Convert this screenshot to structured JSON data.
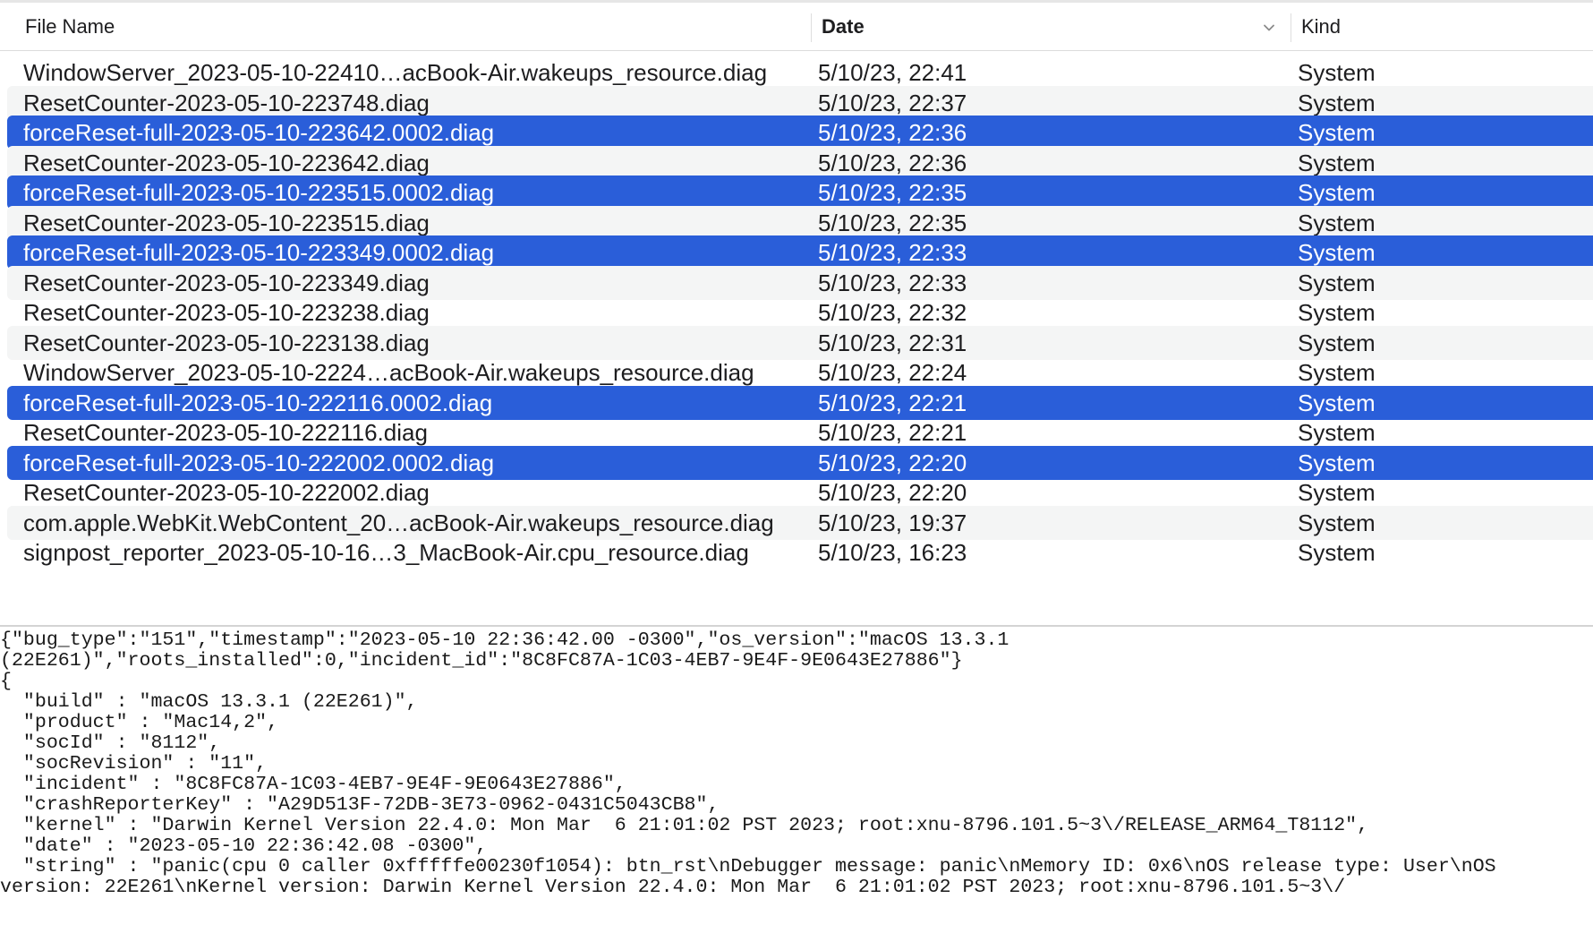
{
  "columns": {
    "name": "File Name",
    "date": "Date",
    "kind": "Kind"
  },
  "files": [
    {
      "name": "WindowServer_2023-05-10-22410…acBook-Air.wakeups_resource.diag",
      "date": "5/10/23, 22:41",
      "kind": "System",
      "selected": false
    },
    {
      "name": "ResetCounter-2023-05-10-223748.diag",
      "date": "5/10/23, 22:37",
      "kind": "System",
      "selected": false
    },
    {
      "name": "forceReset-full-2023-05-10-223642.0002.diag",
      "date": "5/10/23, 22:36",
      "kind": "System",
      "selected": true
    },
    {
      "name": "ResetCounter-2023-05-10-223642.diag",
      "date": "5/10/23, 22:36",
      "kind": "System",
      "selected": false
    },
    {
      "name": "forceReset-full-2023-05-10-223515.0002.diag",
      "date": "5/10/23, 22:35",
      "kind": "System",
      "selected": true
    },
    {
      "name": "ResetCounter-2023-05-10-223515.diag",
      "date": "5/10/23, 22:35",
      "kind": "System",
      "selected": false
    },
    {
      "name": "forceReset-full-2023-05-10-223349.0002.diag",
      "date": "5/10/23, 22:33",
      "kind": "System",
      "selected": true
    },
    {
      "name": "ResetCounter-2023-05-10-223349.diag",
      "date": "5/10/23, 22:33",
      "kind": "System",
      "selected": false
    },
    {
      "name": "ResetCounter-2023-05-10-223238.diag",
      "date": "5/10/23, 22:32",
      "kind": "System",
      "selected": false
    },
    {
      "name": "ResetCounter-2023-05-10-223138.diag",
      "date": "5/10/23, 22:31",
      "kind": "System",
      "selected": false
    },
    {
      "name": "WindowServer_2023-05-10-2224…acBook-Air.wakeups_resource.diag",
      "date": "5/10/23, 22:24",
      "kind": "System",
      "selected": false
    },
    {
      "name": "forceReset-full-2023-05-10-222116.0002.diag",
      "date": "5/10/23, 22:21",
      "kind": "System",
      "selected": true
    },
    {
      "name": "ResetCounter-2023-05-10-222116.diag",
      "date": "5/10/23, 22:21",
      "kind": "System",
      "selected": false
    },
    {
      "name": "forceReset-full-2023-05-10-222002.0002.diag",
      "date": "5/10/23, 22:20",
      "kind": "System",
      "selected": true
    },
    {
      "name": "ResetCounter-2023-05-10-222002.diag",
      "date": "5/10/23, 22:20",
      "kind": "System",
      "selected": false
    },
    {
      "name": "com.apple.WebKit.WebContent_20…acBook-Air.wakeups_resource.diag",
      "date": "5/10/23, 19:37",
      "kind": "System",
      "selected": false
    },
    {
      "name": "signpost_reporter_2023-05-10-16…3_MacBook-Air.cpu_resource.diag",
      "date": "5/10/23, 16:23",
      "kind": "System",
      "selected": false
    }
  ],
  "content_lines": [
    "{\"bug_type\":\"151\",\"timestamp\":\"2023-05-10 22:36:42.00 -0300\",\"os_version\":\"macOS 13.3.1",
    "(22E261)\",\"roots_installed\":0,\"incident_id\":\"8C8FC87A-1C03-4EB7-9E4F-9E0643E27886\"}",
    "{",
    "  \"build\" : \"macOS 13.3.1 (22E261)\",",
    "  \"product\" : \"Mac14,2\",",
    "  \"socId\" : \"8112\",",
    "  \"socRevision\" : \"11\",",
    "  \"incident\" : \"8C8FC87A-1C03-4EB7-9E4F-9E0643E27886\",",
    "  \"crashReporterKey\" : \"A29D513F-72DB-3E73-0962-0431C5043CB8\",",
    "  \"kernel\" : \"Darwin Kernel Version 22.4.0: Mon Mar  6 21:01:02 PST 2023; root:xnu-8796.101.5~3\\/RELEASE_ARM64_T8112\",",
    "  \"date\" : \"2023-05-10 22:36:42.08 -0300\",",
    "  \"string\" : \"panic(cpu 0 caller 0xfffffe00230f1054): btn_rst\\nDebugger message: panic\\nMemory ID: 0x6\\nOS release type: User\\nOS",
    "version: 22E261\\nKernel version: Darwin Kernel Version 22.4.0: Mon Mar  6 21:01:02 PST 2023; root:xnu-8796.101.5~3\\/"
  ],
  "colors": {
    "selection": "#2a5ed9",
    "alternate_row": "#f4f5f5"
  },
  "icons": {
    "sort_indicator": "chevron-down-icon"
  }
}
